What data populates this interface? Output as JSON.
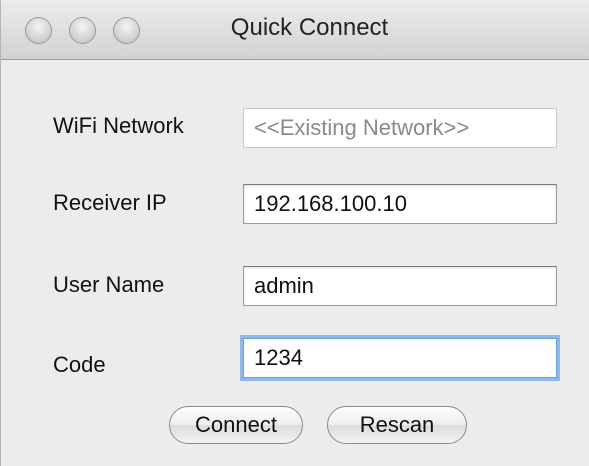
{
  "window": {
    "title": "Quick Connect"
  },
  "form": {
    "wifi": {
      "label": "WiFi Network",
      "value": "<<Existing Network>>"
    },
    "receiver_ip": {
      "label": "Receiver IP",
      "value": "192.168.100.10"
    },
    "user_name": {
      "label": "User Name",
      "value": "admin"
    },
    "code": {
      "label": "Code",
      "value": "1234"
    }
  },
  "buttons": {
    "connect": "Connect",
    "rescan": "Rescan"
  },
  "colors": {
    "focus_ring": "#8db9ec",
    "window_bg": "#ececec"
  }
}
